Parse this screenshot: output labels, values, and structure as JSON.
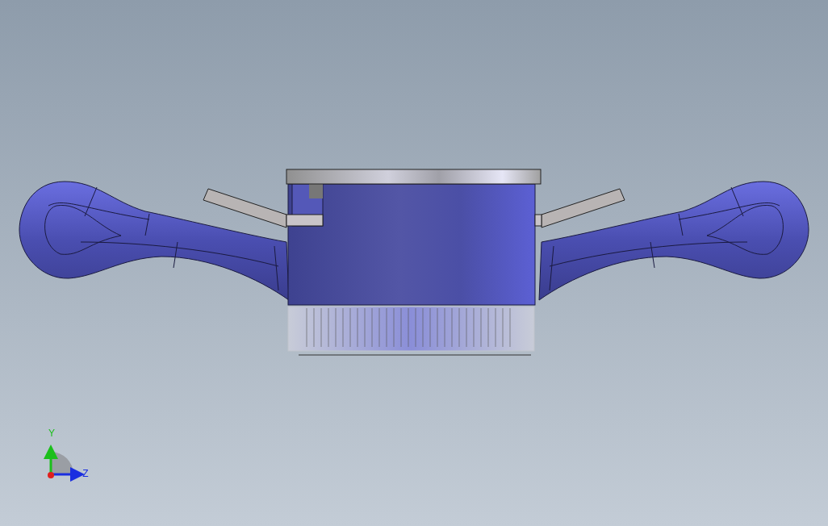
{
  "viewport": {
    "model": {
      "kind": "wing-nut"
    },
    "triad": {
      "axes": [
        {
          "kind": "y",
          "label": "Y"
        },
        {
          "kind": "z",
          "label": "Z"
        }
      ]
    }
  }
}
